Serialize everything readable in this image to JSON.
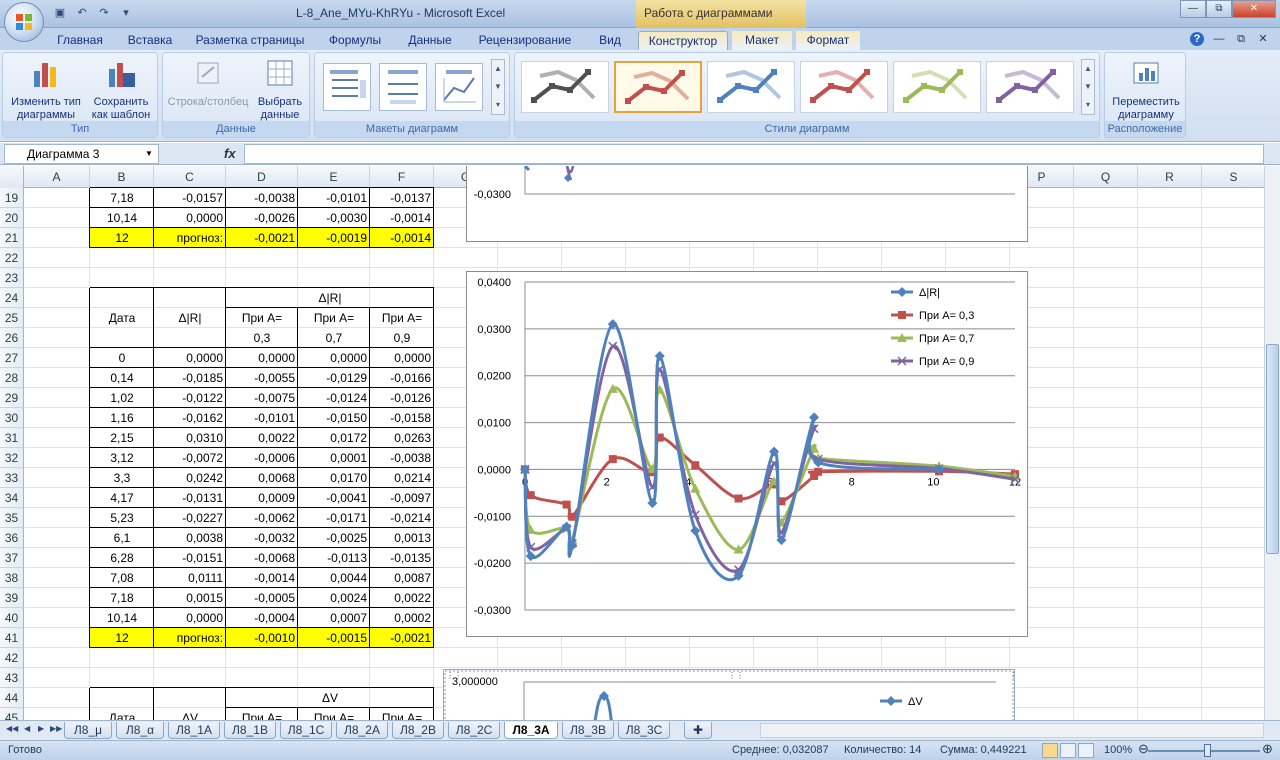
{
  "window": {
    "title": "L-8_Ane_MYu-KhRYu  -  Microsoft Excel",
    "context_title": "Работа с диаграммами"
  },
  "ribbon": {
    "tabs": [
      "Главная",
      "Вставка",
      "Разметка страницы",
      "Формулы",
      "Данные",
      "Рецензирование",
      "Вид",
      "Конструктор",
      "Макет",
      "Формат"
    ],
    "active_tab": "Конструктор",
    "groups": {
      "type": {
        "label": "Тип",
        "change_type": "Изменить тип диаграммы",
        "save_template": "Сохранить как шаблон"
      },
      "data": {
        "label": "Данные",
        "switch": "Строка/столбец",
        "select": "Выбрать данные"
      },
      "layouts": {
        "label": "Макеты диаграмм"
      },
      "styles": {
        "label": "Стили диаграмм",
        "colors": [
          "#505050",
          "#c0504d",
          "#4f81bd",
          "#c0504d",
          "#9bbb59",
          "#8064a2"
        ]
      },
      "location": {
        "label": "Расположение",
        "move": "Переместить диаграмму"
      }
    }
  },
  "formula_bar": {
    "name_box": "Диаграмма 3",
    "fx": "fx",
    "content": ""
  },
  "columns": [
    "A",
    "B",
    "C",
    "D",
    "E",
    "F",
    "G",
    "H",
    "I",
    "J",
    "K",
    "L",
    "M",
    "N",
    "O",
    "P",
    "Q",
    "R",
    "S"
  ],
  "rows": [
    "19",
    "20",
    "21",
    "22",
    "23",
    "24",
    "25",
    "26",
    "27",
    "28",
    "29",
    "30",
    "31",
    "32",
    "33",
    "34",
    "35",
    "36",
    "37",
    "38",
    "39",
    "40",
    "41",
    "42",
    "43",
    "44",
    "45"
  ],
  "sheet": {
    "top_rows": [
      {
        "b": "7,18",
        "c": "-0,0157",
        "d": "-0,0038",
        "e": "-0,0101",
        "f": "-0,0137"
      },
      {
        "b": "10,14",
        "c": "0,0000",
        "d": "-0,0026",
        "e": "-0,0030",
        "f": "-0,0014"
      },
      {
        "b": "12",
        "c": "прогноз:",
        "d": "-0,0021",
        "e": "-0,0019",
        "f": "-0,0014"
      }
    ],
    "table1": {
      "group_header": "Δ|R|",
      "date": "Дата",
      "delta": "Δ|R|",
      "pri_a": "При А=",
      "a_values": [
        "0,3",
        "0,7",
        "0,9"
      ],
      "rows": [
        [
          "0",
          "0,0000",
          "0,0000",
          "0,0000",
          "0,0000"
        ],
        [
          "0,14",
          "-0,0185",
          "-0,0055",
          "-0,0129",
          "-0,0166"
        ],
        [
          "1,02",
          "-0,0122",
          "-0,0075",
          "-0,0124",
          "-0,0126"
        ],
        [
          "1,16",
          "-0,0162",
          "-0,0101",
          "-0,0150",
          "-0,0158"
        ],
        [
          "2,15",
          "0,0310",
          "0,0022",
          "0,0172",
          "0,0263"
        ],
        [
          "3,12",
          "-0,0072",
          "-0,0006",
          "0,0001",
          "-0,0038"
        ],
        [
          "3,3",
          "0,0242",
          "0,0068",
          "0,0170",
          "0,0214"
        ],
        [
          "4,17",
          "-0,0131",
          "0,0009",
          "-0,0041",
          "-0,0097"
        ],
        [
          "5,23",
          "-0,0227",
          "-0,0062",
          "-0,0171",
          "-0,0214"
        ],
        [
          "6,1",
          "0,0038",
          "-0,0032",
          "-0,0025",
          "0,0013"
        ],
        [
          "6,28",
          "-0,0151",
          "-0,0068",
          "-0,0113",
          "-0,0135"
        ],
        [
          "7,08",
          "0,0111",
          "-0,0014",
          "0,0044",
          "0,0087"
        ],
        [
          "7,18",
          "0,0015",
          "-0,0005",
          "0,0024",
          "0,0022"
        ],
        [
          "10,14",
          "0,0000",
          "-0,0004",
          "0,0007",
          "0,0002"
        ]
      ],
      "forecast": {
        "b": "12",
        "c": "прогноз:",
        "d": "-0,0010",
        "e": "-0,0015",
        "f": "-0,0021"
      }
    },
    "table2": {
      "group_header": "ΔV",
      "date": "Дата",
      "delta": "ΔV",
      "pri_a": "При А="
    }
  },
  "chart_data": [
    {
      "type": "line",
      "title": "",
      "ylabel": "",
      "xlabel": "",
      "ylim": [
        -0.03,
        0.04
      ],
      "xlim": [
        0,
        12
      ],
      "y_ticks": [
        "0,0400",
        "0,0300",
        "0,0200",
        "0,0100",
        "0,0000",
        "-0,0100",
        "-0,0200",
        "-0,0300"
      ],
      "x_ticks": [
        "0",
        "2",
        "4",
        "6",
        "8",
        "10",
        "12"
      ],
      "legend": "top-right",
      "grid": true,
      "x": [
        0,
        0.14,
        1.02,
        1.16,
        2.15,
        3.12,
        3.3,
        4.17,
        5.23,
        6.1,
        6.28,
        7.08,
        7.18,
        10.14,
        12
      ],
      "series": [
        {
          "name": "Δ|R|",
          "color": "#4f81bd",
          "marker": "diamond",
          "values": [
            0,
            -0.0185,
            -0.0122,
            -0.0162,
            0.031,
            -0.0072,
            0.0242,
            -0.0131,
            -0.0227,
            0.0038,
            -0.0151,
            0.0111,
            0.0015,
            0.0,
            null
          ]
        },
        {
          "name": "При А= 0,3",
          "color": "#c0504d",
          "marker": "square",
          "values": [
            0,
            -0.0055,
            -0.0075,
            -0.0101,
            0.0022,
            -0.0006,
            0.0068,
            0.0009,
            -0.0062,
            -0.0032,
            -0.0068,
            -0.0014,
            -0.0005,
            -0.0004,
            -0.001
          ]
        },
        {
          "name": "При А= 0,7",
          "color": "#9bbb59",
          "marker": "triangle",
          "values": [
            0,
            -0.0129,
            -0.0124,
            -0.015,
            0.0172,
            0.0001,
            0.017,
            -0.0041,
            -0.0171,
            -0.0025,
            -0.0113,
            0.0044,
            0.0024,
            0.0007,
            -0.0015
          ]
        },
        {
          "name": "При А= 0,9",
          "color": "#8064a2",
          "marker": "x",
          "values": [
            0,
            -0.0166,
            -0.0126,
            -0.0158,
            0.0263,
            -0.0038,
            0.0214,
            -0.0097,
            -0.0214,
            0.0013,
            -0.0135,
            0.0087,
            0.0022,
            0.0002,
            -0.0021
          ]
        }
      ]
    },
    {
      "type": "line",
      "title": "",
      "y_tick_label": "-0,0300",
      "ylim": [
        -0.03,
        0.04
      ]
    },
    {
      "type": "line",
      "title": "",
      "y_tick_label": "3,000000",
      "legend": "top-right",
      "series": [
        {
          "name": "ΔV",
          "color": "#4f81bd",
          "marker": "diamond"
        }
      ]
    }
  ],
  "sheet_tabs": {
    "tabs": [
      "Л8_μ",
      "Л8_α",
      "Л8_1A",
      "Л8_1B",
      "Л8_1C",
      "Л8_2A",
      "Л8_2B",
      "Л8_2C",
      "Л8_3A",
      "Л8_3B",
      "Л8_3C"
    ],
    "active": "Л8_3A"
  },
  "status": {
    "ready": "Готово",
    "average": "Среднее: 0,032087",
    "count": "Количество: 14",
    "sum": "Сумма: 0,449221",
    "zoom": "100%"
  }
}
